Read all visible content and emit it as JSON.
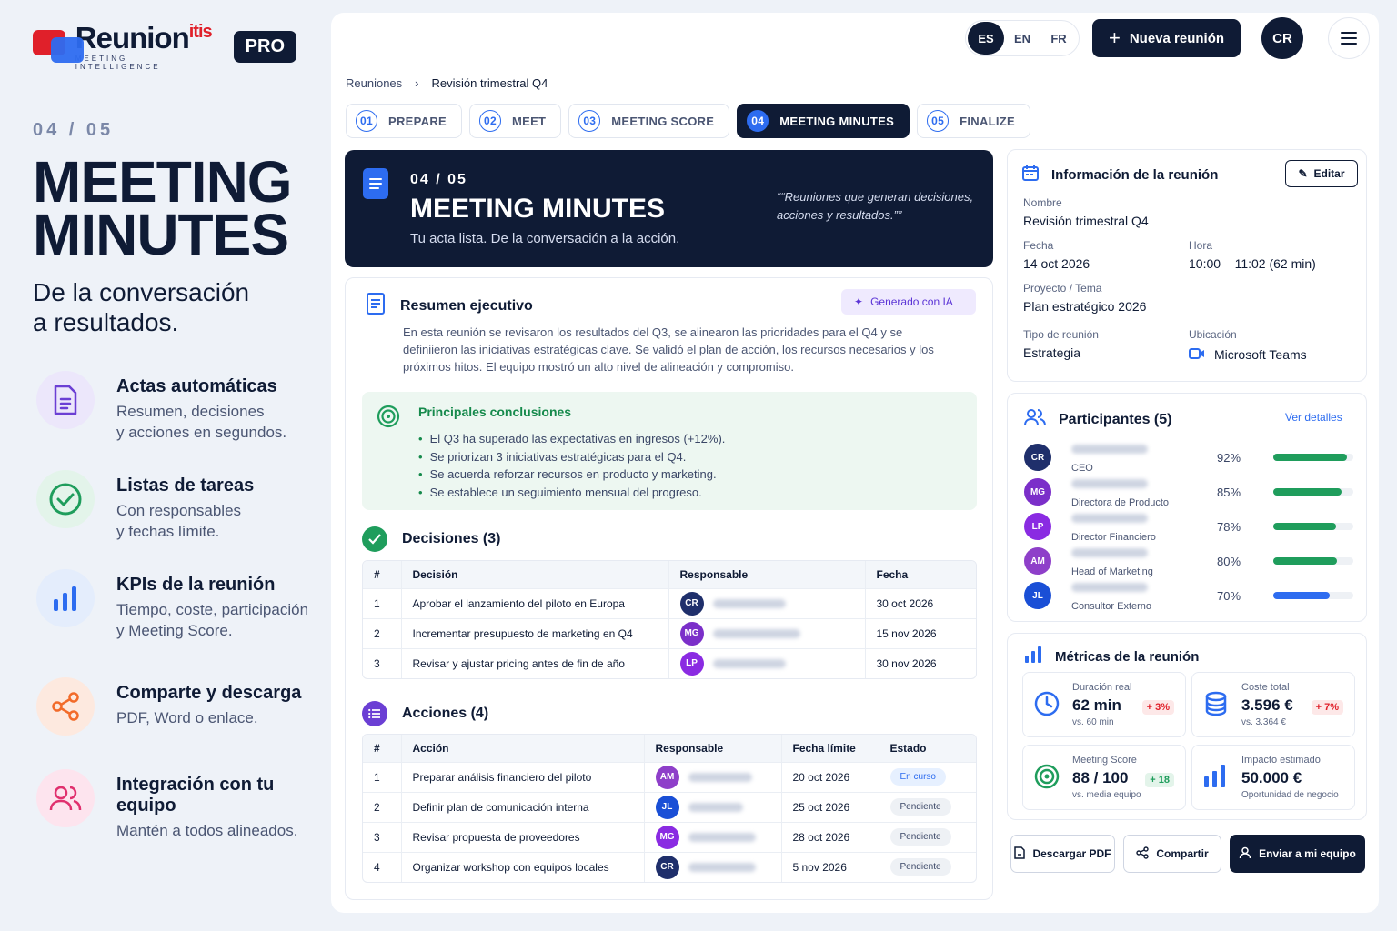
{
  "brand": {
    "name": "Reunion",
    "name_sup": "itis",
    "tagline": "MEETING INTELLIGENCE",
    "badge": "PRO"
  },
  "intro": {
    "step": "04 / 05",
    "title_line1": "MEETING",
    "title_line2": "MINUTES",
    "subtitle_line1": "De la conversación",
    "subtitle_line2": "a resultados."
  },
  "features": [
    {
      "title": "Actas automáticas",
      "desc1": "Resumen, decisiones",
      "desc2": "y acciones en segundos.",
      "icon": "document-icon"
    },
    {
      "title": "Listas de tareas",
      "desc1": "Con responsables",
      "desc2": "y fechas límite.",
      "icon": "check-circle-icon"
    },
    {
      "title": "KPIs de la reunión",
      "desc1": "Tiempo, coste, participación",
      "desc2": "y Meeting Score.",
      "icon": "bar-chart-icon"
    },
    {
      "title": "Comparte y descarga",
      "desc1": "PDF, Word o enlace.",
      "desc2": "",
      "icon": "share-icon"
    },
    {
      "title": "Integración con tu equipo",
      "desc1": "Mantén a todos alineados.",
      "desc2": "",
      "icon": "users-icon"
    }
  ],
  "topbar": {
    "langs": [
      "ES",
      "EN",
      "FR"
    ],
    "active_lang": "ES",
    "new_meeting": "Nueva reunión",
    "user_initials": "CR"
  },
  "breadcrumb": {
    "root": "Reuniones",
    "current": "Revisión trimestral Q4"
  },
  "tabs": [
    {
      "num": "01",
      "label": "PREPARE"
    },
    {
      "num": "02",
      "label": "MEET"
    },
    {
      "num": "03",
      "label": "MEETING SCORE"
    },
    {
      "num": "04",
      "label": "MEETING MINUTES"
    },
    {
      "num": "05",
      "label": "FINALIZE"
    }
  ],
  "hero": {
    "step": "04 / 05",
    "title": "MEETING MINUTES",
    "subtitle": "Tu acta lista. De la conversación a la acción.",
    "quote": "“Reuniones que generan decisiones, acciones y resultados.”"
  },
  "summary": {
    "title": "Resumen ejecutivo",
    "ai_badge": "Generado con IA",
    "text": "En esta reunión se revisaron los resultados del Q3, se alinearon las prioridades para el Q4 y se definiieron las iniciativas estratégicas clave. Se validó el plan de acción, los recursos necesarios y los próximos hitos. El equipo mostró un alto nivel de alineación y compromiso.",
    "conclusions_title": "Principales conclusiones",
    "conclusions": [
      "El Q3 ha superado las expectativas en ingresos (+12%).",
      "Se priorizan 3 iniciativas estratégicas para el Q4.",
      "Se acuerda reforzar recursos en producto y marketing.",
      "Se establece un seguimiento mensual del progreso."
    ]
  },
  "decisions": {
    "title": "Decisiones (3)",
    "headers": [
      "#",
      "Decisión",
      "Responsable",
      "Fecha"
    ],
    "rows": [
      {
        "n": "1",
        "text": "Aprobar el lanzamiento del piloto en Europa",
        "owner": "CR",
        "date": "30 oct 2026"
      },
      {
        "n": "2",
        "text": "Incrementar presupuesto de marketing en Q4",
        "owner": "MG",
        "date": "15 nov 2026"
      },
      {
        "n": "3",
        "text": "Revisar y ajustar pricing antes de fin de año",
        "owner": "LP",
        "date": "30 nov 2026"
      }
    ]
  },
  "actions": {
    "title": "Acciones (4)",
    "headers": [
      "#",
      "Acción",
      "Responsable",
      "Fecha límite",
      "Estado"
    ],
    "rows": [
      {
        "n": "1",
        "text": "Preparar análisis financiero del piloto",
        "owner": "AM",
        "date": "20 oct 2026",
        "status": "En curso"
      },
      {
        "n": "2",
        "text": "Definir plan de comunicación interna",
        "owner": "JL",
        "date": "25 oct 2026",
        "status": "Pendiente"
      },
      {
        "n": "3",
        "text": "Revisar propuesta de proveedores",
        "owner": "MG",
        "date": "28 oct 2026",
        "status": "Pendiente"
      },
      {
        "n": "4",
        "text": "Organizar workshop con equipos locales",
        "owner": "CR",
        "date": "5 nov 2026",
        "status": "Pendiente"
      }
    ]
  },
  "info": {
    "title": "Información de la reunión",
    "edit": "Editar",
    "name_label": "Nombre",
    "name": "Revisión trimestral Q4",
    "date_label": "Fecha",
    "date": "14 oct 2026",
    "time_label": "Hora",
    "time": "10:00 – 11:02 (62 min)",
    "project_label": "Proyecto / Tema",
    "project": "Plan estratégico 2026",
    "type_label": "Tipo de reunión",
    "type": "Estrategia",
    "location_label": "Ubicación",
    "location": "Microsoft Teams"
  },
  "participants": {
    "title": "Participantes (5)",
    "details": "Ver detalles",
    "list": [
      {
        "initials": "CR",
        "role": "CEO",
        "pct": "92%",
        "value": 0.92,
        "color": "#1f2f6b",
        "bar": "#1f9d5c"
      },
      {
        "initials": "MG",
        "role": "Directora de Producto",
        "pct": "85%",
        "value": 0.85,
        "color": "#7b2fc9",
        "bar": "#1f9d5c"
      },
      {
        "initials": "LP",
        "role": "Director Financiero",
        "pct": "78%",
        "value": 0.78,
        "color": "#8a2be2",
        "bar": "#1f9d5c"
      },
      {
        "initials": "AM",
        "role": "Head of Marketing",
        "pct": "80%",
        "value": 0.8,
        "color": "#8e3fc9",
        "bar": "#1f9d5c"
      },
      {
        "initials": "JL",
        "role": "Consultor Externo",
        "pct": "70%",
        "value": 0.7,
        "color": "#1a4fd6",
        "bar": "#2d6cf0"
      }
    ]
  },
  "metrics": {
    "title": "Métricas de la reunión",
    "items": [
      {
        "label": "Duración real",
        "value": "62 min",
        "sub": "vs. 60 min",
        "delta": "+ 3%",
        "icon": "clock-icon"
      },
      {
        "label": "Coste total",
        "value": "3.596 €",
        "sub": "vs. 3.364 €",
        "delta": "+ 7%",
        "icon": "coins-icon"
      },
      {
        "label": "Meeting Score",
        "value": "88 / 100",
        "sub": "vs. media equipo",
        "delta": "+ 18",
        "icon": "target-icon"
      },
      {
        "label": "Impacto estimado",
        "value": "50.000 €",
        "sub": "Oportunidad de negocio",
        "delta": "",
        "icon": "bar-chart-icon"
      }
    ]
  },
  "buttons": {
    "pdf": "Descargar PDF",
    "share": "Compartir",
    "send": "Enviar a mi equipo"
  },
  "colors": {
    "navy": "#0f1b35",
    "accent": "#2d6cf0",
    "red": "#e0202a",
    "green": "#1f9d5c"
  }
}
